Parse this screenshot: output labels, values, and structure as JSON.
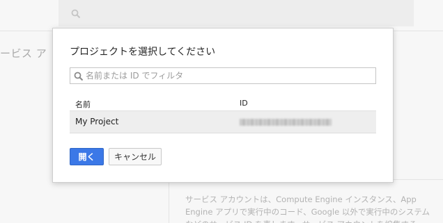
{
  "background": {
    "search_icon": "search-icon",
    "page_title_fragment": "ービス ア",
    "description": "サービス アカウントは、Compute Engine インスタンス、App Engine アプリで実行中のコード、Google 以外で実行中のシステムなどのサービス ID を表します。サービス アカウントを編集する"
  },
  "dialog": {
    "title": "プロジェクトを選択してください",
    "filter": {
      "icon": "search-icon",
      "placeholder": "名前または ID でフィルタ",
      "value": ""
    },
    "table": {
      "columns": [
        "名前",
        "ID"
      ],
      "rows": [
        {
          "name": "My Project",
          "id": ""
        }
      ]
    },
    "buttons": {
      "open_label": "開く",
      "cancel_label": "キャンセル"
    }
  },
  "colors": {
    "primary": "#3b78e7",
    "selected_row": "#eeeeee",
    "page_bg": "#f7f7f7"
  }
}
